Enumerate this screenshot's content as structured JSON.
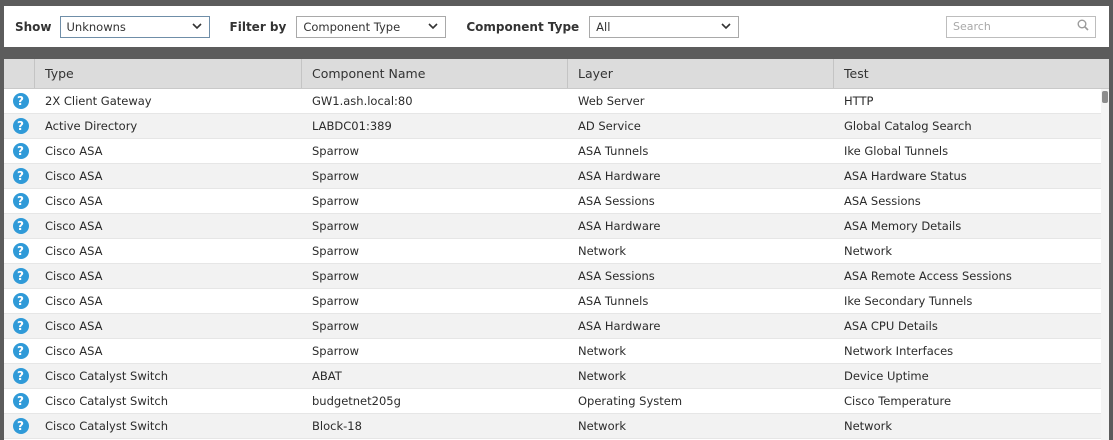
{
  "toolbar": {
    "show_label": "Show",
    "show_value": "Unknowns",
    "filter_label": "Filter by",
    "filter_value": "Component Type",
    "component_type_label": "Component Type",
    "component_type_value": "All",
    "search_placeholder": "Search"
  },
  "table": {
    "columns": [
      "Type",
      "Component Name",
      "Layer",
      "Test"
    ],
    "rows": [
      [
        "2X Client Gateway",
        "GW1.ash.local:80",
        "Web Server",
        "HTTP"
      ],
      [
        "Active Directory",
        "LABDC01:389",
        "AD Service",
        "Global Catalog Search"
      ],
      [
        "Cisco ASA",
        "Sparrow",
        "ASA Tunnels",
        "Ike Global Tunnels"
      ],
      [
        "Cisco ASA",
        "Sparrow",
        "ASA Hardware",
        "ASA Hardware Status"
      ],
      [
        "Cisco ASA",
        "Sparrow",
        "ASA Sessions",
        "ASA Sessions"
      ],
      [
        "Cisco ASA",
        "Sparrow",
        "ASA Hardware",
        "ASA Memory Details"
      ],
      [
        "Cisco ASA",
        "Sparrow",
        "Network",
        "Network"
      ],
      [
        "Cisco ASA",
        "Sparrow",
        "ASA Sessions",
        "ASA Remote Access Sessions"
      ],
      [
        "Cisco ASA",
        "Sparrow",
        "ASA Tunnels",
        "Ike Secondary Tunnels"
      ],
      [
        "Cisco ASA",
        "Sparrow",
        "ASA Hardware",
        "ASA CPU Details"
      ],
      [
        "Cisco ASA",
        "Sparrow",
        "Network",
        "Network Interfaces"
      ],
      [
        "Cisco Catalyst Switch",
        "ABAT",
        "Network",
        "Device Uptime"
      ],
      [
        "Cisco Catalyst Switch",
        "budgetnet205g",
        "Operating System",
        "Cisco Temperature"
      ],
      [
        "Cisco Catalyst Switch",
        "Block-18",
        "Network",
        "Network"
      ]
    ],
    "row_icon": "question-circle-icon",
    "row_icon_glyph": "?"
  },
  "colors": {
    "status_unknown": "#2f9ad8",
    "header_bg": "#dcdcdc",
    "frame": "#5c5c5c"
  }
}
